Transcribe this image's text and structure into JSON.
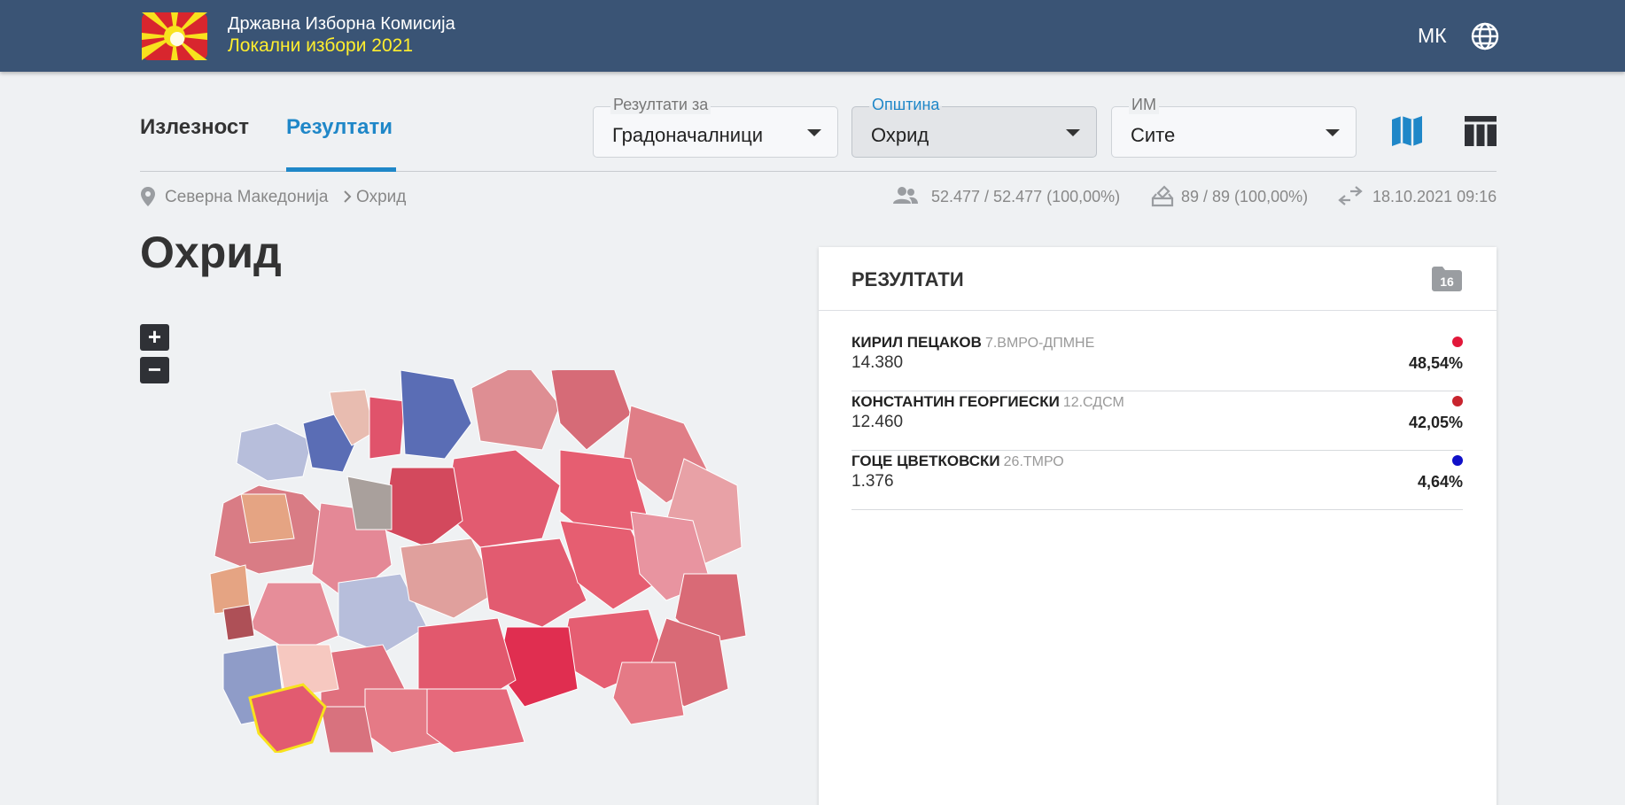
{
  "header": {
    "title": "Државна Изборна Комисија",
    "subtitle": "Локални избори 2021",
    "language": "МК"
  },
  "tabs": [
    {
      "label": "Излезност",
      "active": false
    },
    {
      "label": "Резултати",
      "active": true
    }
  ],
  "filters": [
    {
      "label": "Резултати за",
      "value": "Градоначалници"
    },
    {
      "label": "Општина",
      "value": "Охрид"
    },
    {
      "label": "ИМ",
      "value": "Сите"
    }
  ],
  "breadcrumb": [
    "Северна Македонија",
    "Охрид"
  ],
  "stats": {
    "voters": "52.477 / 52.477 (100,00%)",
    "polling_stations": "89 / 89 (100,00%)",
    "updated": "18.10.2021 09:16"
  },
  "page_title": "Охрид",
  "zoom": {
    "in": "+",
    "out": "−"
  },
  "results": {
    "title": "РЕЗУЛТАТИ",
    "badge": "16",
    "candidates": [
      {
        "name": "КИРИЛ ПЕЦАКОВ",
        "party": "7.ВМРО-ДПМНЕ",
        "votes": "14.380",
        "percent": "48,54%",
        "color": "#e2183a"
      },
      {
        "name": "КОНСТАНТИН ГЕОРГИЕСКИ",
        "party": "12.СДСМ",
        "votes": "12.460",
        "percent": "42,05%",
        "color": "#c8242e"
      },
      {
        "name": "ГОЦЕ ЦВЕТКОВСКИ",
        "party": "26.ТМРО",
        "votes": "1.376",
        "percent": "4,64%",
        "color": "#1010c8"
      }
    ]
  },
  "icons": {
    "logo": "flag-emblem-logo",
    "globe": "globe-icon",
    "map_view": "map-icon",
    "table_view": "table-icon",
    "pin": "location-pin-icon",
    "voters": "people-icon",
    "ballot": "ballot-box-icon",
    "sync": "sync-arrows-icon",
    "folder": "folder-icon"
  },
  "colors": {
    "header_bg": "#3a5475",
    "accent": "#1f87c8",
    "subtitle": "#ffee2e"
  }
}
